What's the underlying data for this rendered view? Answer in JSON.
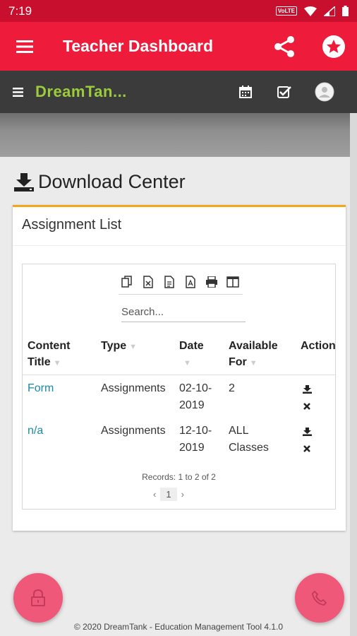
{
  "status": {
    "time": "7:19",
    "network": "VoLTE"
  },
  "app_bar": {
    "title": "Teacher Dashboard"
  },
  "site_header": {
    "brand": "DreamTan..."
  },
  "page": {
    "title": "Download Center"
  },
  "card": {
    "title": "Assignment List",
    "search_placeholder": "Search...",
    "columns": [
      {
        "line1": "Content",
        "line2": "Title"
      },
      {
        "line1": "Type",
        "line2": ""
      },
      {
        "line1": "Date",
        "line2": ""
      },
      {
        "line1": "Available",
        "line2": "For"
      },
      {
        "line1": "Action",
        "line2": ""
      }
    ],
    "rows": [
      {
        "title": "Form",
        "type": "Assignments",
        "date1": "02-10-",
        "date2": "2019",
        "available1": "2",
        "available2": ""
      },
      {
        "title": "n/a",
        "type": "Assignments",
        "date1": "12-10-",
        "date2": "2019",
        "available1": "ALL",
        "available2": "Classes"
      }
    ],
    "records": "Records: 1 to 2 of 2",
    "page_number": "1",
    "prev": "‹",
    "next": "›"
  },
  "footer": {
    "text": "© 2020 DreamTank - Education Management Tool 4.1.0"
  },
  "colors": {
    "status_bar": "#c8102e",
    "app_bar": "#ee1c3a",
    "header": "#3b3b3b",
    "brand": "#9ccc3c",
    "accent": "#f3a51b",
    "fab": "#f0587a",
    "link": "#1a8aa8"
  }
}
